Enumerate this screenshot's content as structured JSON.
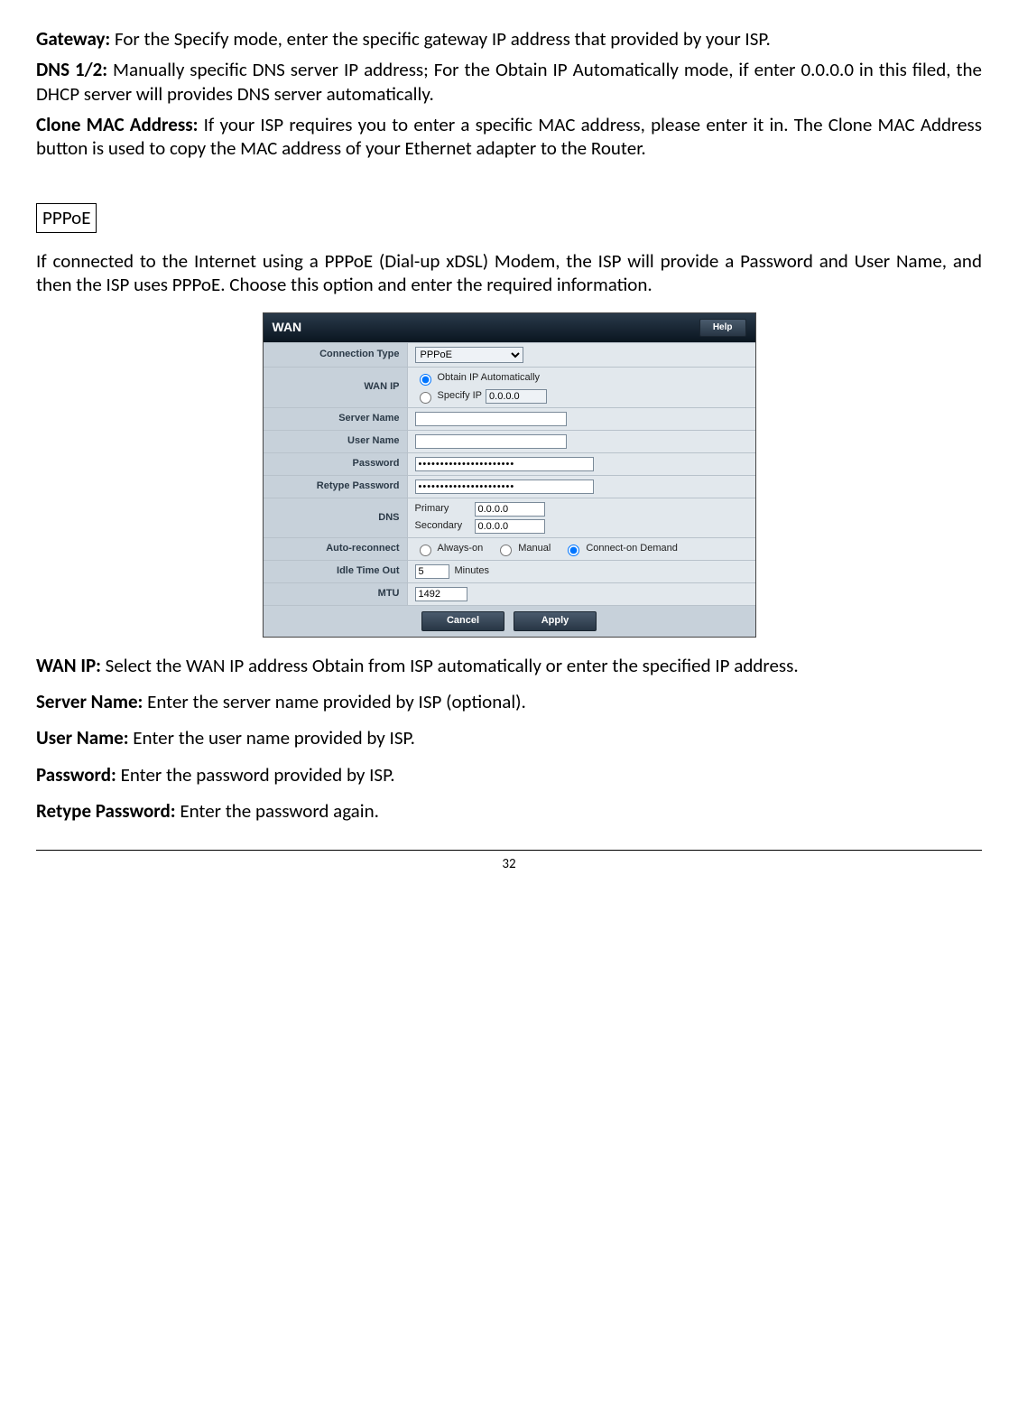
{
  "paragraphs": {
    "gateway_label": "Gateway:",
    "gateway_text": " For the Specify mode, enter the specific gateway IP address that provided by your ISP.",
    "dns_label": "DNS 1/2:",
    "dns_text": " Manually specific DNS server IP address; For the Obtain IP Automatically mode, if enter 0.0.0.0 in this filed, the DHCP server will provides DNS server automatically.",
    "clone_label": "Clone MAC Address:",
    "clone_text": " If your ISP requires you to enter a specific MAC address, please enter it in. The Clone MAC Address button is used to copy the MAC address of your Ethernet adapter to the Router.",
    "pppoe_tag": "PPPoE",
    "pppoe_intro": "If connected to the Internet using a PPPoE (Dial-up xDSL) Modem, the ISP will provide a Password and User Name, and then the ISP uses PPPoE. Choose this option and enter the required information.",
    "wanip_label": "WAN IP:",
    "wanip_text": " Select the WAN IP address Obtain from ISP automatically or enter the specified IP address.",
    "server_label": "Server Name:",
    "server_text": " Enter the server name provided by ISP (optional).",
    "username_label": "User Name:",
    "username_text": " Enter the user name provided by ISP.",
    "password_label": "Password:",
    "password_text": " Enter the password provided by ISP.",
    "retype_label": "Retype Password:",
    "retype_text": " Enter the password again."
  },
  "wan": {
    "title": "WAN",
    "help": "Help",
    "rows": {
      "connection_type": "Connection Type",
      "connection_type_value": "PPPoE",
      "wan_ip": "WAN IP",
      "obtain_auto": "Obtain IP Automatically",
      "specify_ip": "Specify IP",
      "specify_ip_value": "0.0.0.0",
      "server_name": "Server Name",
      "user_name": "User Name",
      "password": "Password",
      "password_value": "••••••••••••••••••••••",
      "retype_password": "Retype Password",
      "retype_value": "••••••••••••••••••••••",
      "dns": "DNS",
      "dns_primary": "Primary",
      "dns_secondary": "Secondary",
      "dns_value": "0.0.0.0",
      "auto_reconnect": "Auto-reconnect",
      "always_on": "Always-on",
      "manual": "Manual",
      "cod": "Connect-on Demand",
      "idle": "Idle Time Out",
      "idle_value": "5",
      "idle_unit": "Minutes",
      "mtu": "MTU",
      "mtu_value": "1492"
    },
    "buttons": {
      "cancel": "Cancel",
      "apply": "Apply"
    }
  },
  "page_number": "32"
}
